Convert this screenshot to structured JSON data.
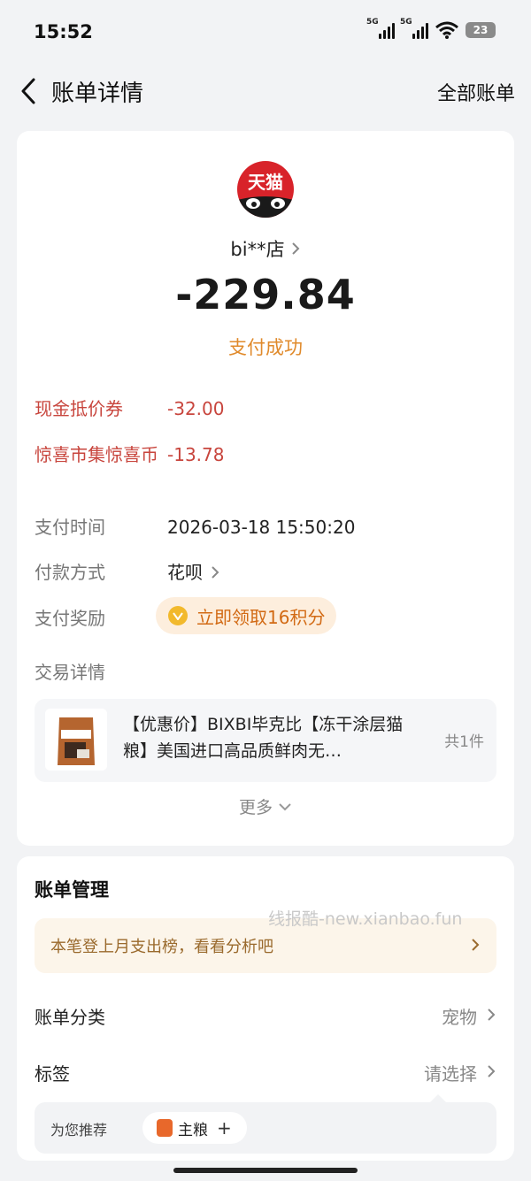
{
  "status_bar": {
    "time": "15:52",
    "signal1_label": "5G",
    "signal2_label": "5G",
    "battery": "23"
  },
  "nav": {
    "back_icon": "chevron-left-icon",
    "title": "账单详情",
    "right_link": "全部账单"
  },
  "merchant": {
    "logo_text": "天猫",
    "store_name": "bi**店",
    "amount": "-229.84",
    "status": "支付成功",
    "status_color": "#e08a2b"
  },
  "details": {
    "cash_coupon": {
      "label": "现金抵价券",
      "value": "-32.00"
    },
    "surprise_coin": {
      "label": "惊喜市集惊喜币",
      "value": "-13.78"
    },
    "pay_time": {
      "label": "支付时间",
      "value": "2026-03-18 15:50:20"
    },
    "pay_method": {
      "label": "付款方式",
      "value": "花呗"
    },
    "reward": {
      "label": "支付奖励",
      "value": "立即领取16积分"
    },
    "trade_detail_label": "交易详情",
    "red_color": "#c8453d"
  },
  "product": {
    "title": "【优惠价】BIXBI毕克比【冻干涂层猫粮】美国进口高品质鲜肉无…",
    "count": "共1件",
    "image_icon": "cat-food-bag-icon"
  },
  "more_label": "更多",
  "management": {
    "title": "账单管理",
    "watermark": "线报酷-new.xianbao.fun",
    "banner_text": "本笔登上月支出榜，看看分析吧",
    "category_label": "账单分类",
    "category_value": "宠物",
    "tag_label": "标签",
    "tag_value": "请选择",
    "recommend_label": "为您推荐",
    "recommend_tag": "主粮",
    "recommend_add": "+"
  }
}
